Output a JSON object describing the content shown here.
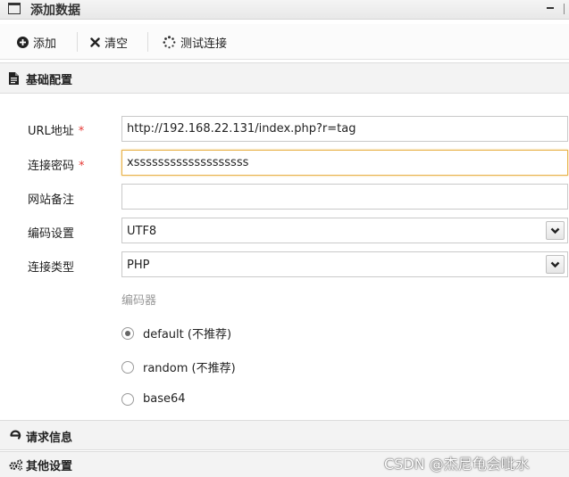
{
  "window": {
    "title": "添加数据"
  },
  "toolbar": {
    "add_label": "添加",
    "clear_label": "清空",
    "test_label": "测试连接"
  },
  "sections": {
    "basic": "基础配置",
    "request": "请求信息",
    "other": "其他设置"
  },
  "form": {
    "url": {
      "label": "URL地址",
      "required": "*",
      "value": "http://192.168.22.131/index.php?r=tag"
    },
    "password": {
      "label": "连接密码",
      "required": "*",
      "value": "xsssssssssssssssssss"
    },
    "note": {
      "label": "网站备注",
      "value": ""
    },
    "encoding": {
      "label": "编码设置",
      "value": "UTF8"
    },
    "type": {
      "label": "连接类型",
      "value": "PHP"
    },
    "encoder": {
      "label": "编码器",
      "options": [
        "default (不推荐)",
        "random (不推荐)",
        "base64"
      ],
      "selected": "default (不推荐)"
    }
  },
  "watermark": "CSDN @杰尼龟会呲水"
}
